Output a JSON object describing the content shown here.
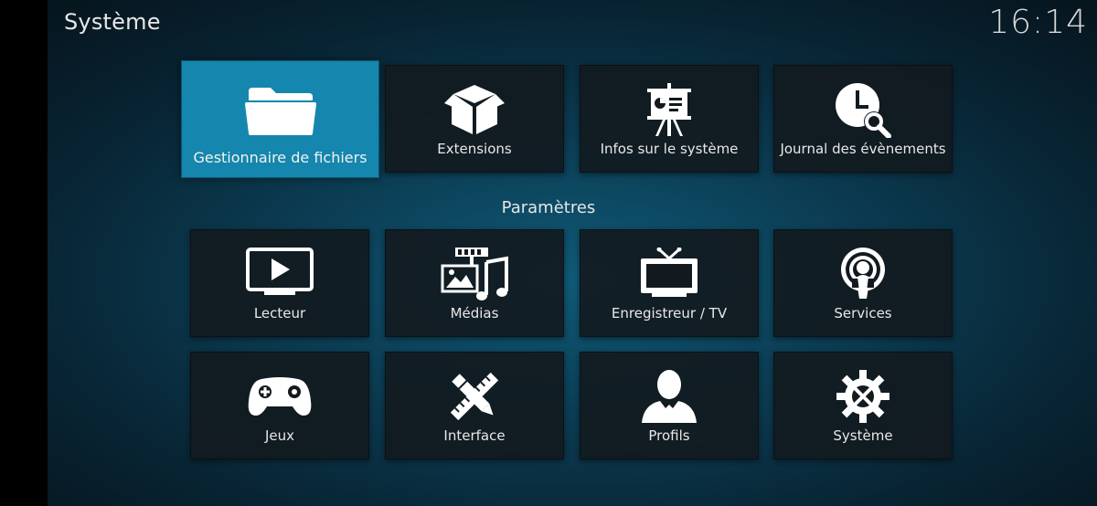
{
  "header": {
    "title": "Système",
    "clock": "16:14"
  },
  "top_row": [
    {
      "label": "Gestionnaire de fichiers",
      "icon": "folder-icon",
      "focused": true
    },
    {
      "label": "Extensions",
      "icon": "box-icon"
    },
    {
      "label": "Infos sur le système",
      "icon": "presentation-icon"
    },
    {
      "label": "Journal des évènements",
      "icon": "clock-search-icon"
    }
  ],
  "settings": {
    "section_title": "Paramètres",
    "row1": [
      {
        "label": "Lecteur",
        "icon": "monitor-play-icon"
      },
      {
        "label": "Médias",
        "icon": "media-icon"
      },
      {
        "label": "Enregistreur / TV",
        "icon": "tv-icon"
      },
      {
        "label": "Services",
        "icon": "podcast-icon"
      }
    ],
    "row2": [
      {
        "label": "Jeux",
        "icon": "gamepad-icon"
      },
      {
        "label": "Interface",
        "icon": "pencil-ruler-icon"
      },
      {
        "label": "Profils",
        "icon": "user-icon"
      },
      {
        "label": "Système",
        "icon": "gear-tools-icon"
      }
    ]
  },
  "colors": {
    "focus": "#1586ad",
    "tile": "#121a20",
    "text": "#e8e8e8"
  }
}
